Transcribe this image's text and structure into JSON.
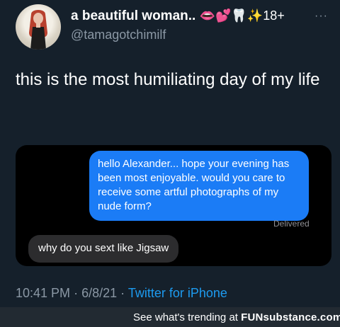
{
  "tweet": {
    "display_name": "a beautiful woman..",
    "name_emojis": "👄💕🦷✨18+",
    "handle": "@tamagotchimilf",
    "text": "this is the most humiliating day of my life",
    "time": "10:41 PM",
    "date": "6/8/21",
    "separator": "·",
    "source": "Twitter for iPhone",
    "more_icon": "···"
  },
  "messages": {
    "sent": "hello Alexander... hope your evening has been most enjoyable. would you care to receive some artful photographs of my nude form?",
    "status": "Delivered",
    "received": "why do you sext like Jigsaw"
  },
  "footer": {
    "prefix": "See what's trending at ",
    "brand": "FUNsubstance.com"
  },
  "colors": {
    "background": "#15202b",
    "link": "#1d9bf0",
    "imessage_blue": "#1b7cf6"
  }
}
